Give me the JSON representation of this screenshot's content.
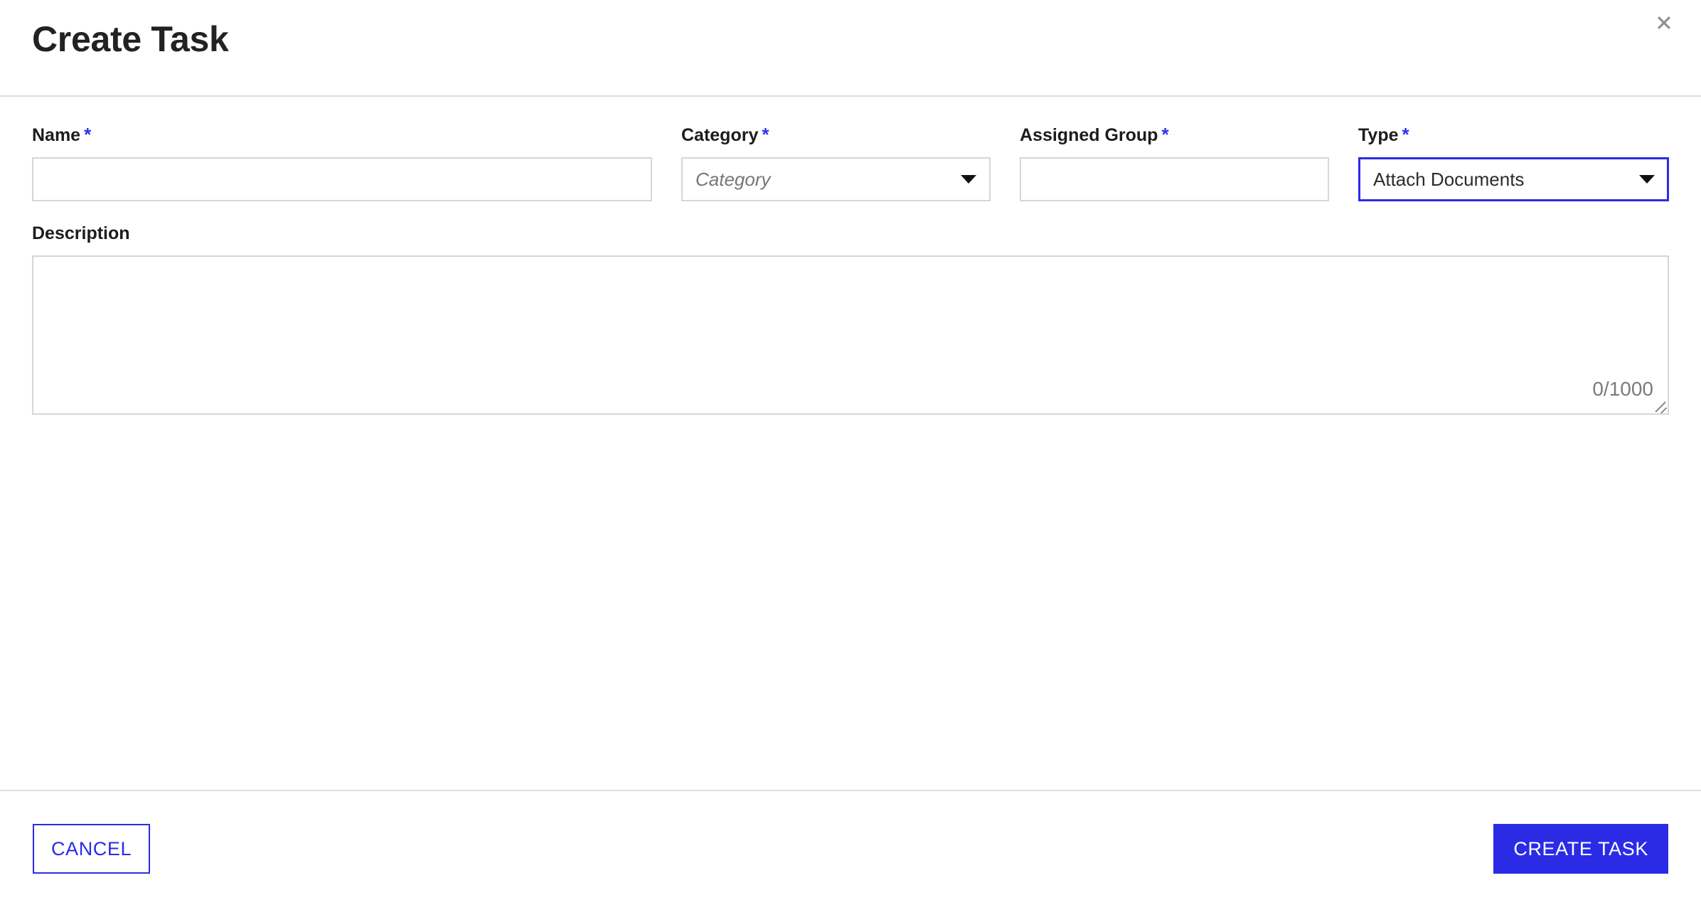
{
  "dialog": {
    "title": "Create Task",
    "close_icon": "close-icon"
  },
  "colors": {
    "accent_blue": "#2b2be6",
    "required_asterisk": "#3232e6",
    "border_gray": "#d6d6d6",
    "divider_gray": "#dedede",
    "title_text": "#222222",
    "placeholder_text": "#767676",
    "counter_text": "#7b7b7b",
    "close_icon": "#8f8f8f"
  },
  "form": {
    "fields": [
      {
        "key": "name",
        "label": "Name",
        "required_marker": "*",
        "control": "text-input",
        "value": "",
        "placeholder": ""
      },
      {
        "key": "category",
        "label": "Category",
        "required_marker": "*",
        "control": "select",
        "value": "",
        "placeholder": "Category",
        "arrow_icon": "chevron-down-icon",
        "focused": false
      },
      {
        "key": "assigned_group",
        "label": "Assigned Group",
        "required_marker": "*",
        "control": "text-input",
        "value": "",
        "placeholder": ""
      },
      {
        "key": "type",
        "label": "Type",
        "required_marker": "*",
        "control": "select",
        "value": "Attach Documents",
        "placeholder": "",
        "arrow_icon": "chevron-down-icon",
        "focused": true
      }
    ],
    "description": {
      "label": "Description",
      "value": "",
      "placeholder": "",
      "char_counter": "0/1000",
      "max_length": 1000,
      "current_length": 0
    }
  },
  "footer": {
    "cancel_label": "CANCEL",
    "submit_label": "CREATE TASK"
  }
}
